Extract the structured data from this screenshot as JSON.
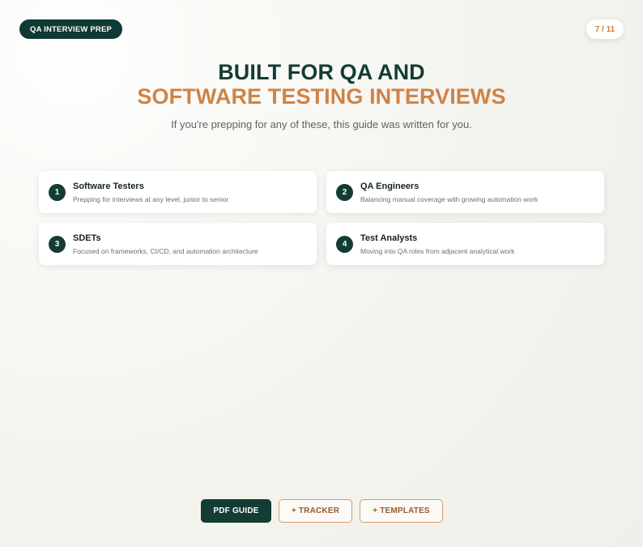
{
  "header": {
    "tag": "QA INTERVIEW PREP",
    "page_counter": "7 / 11"
  },
  "hero": {
    "title_line1": "BUILT FOR QA AND",
    "title_line2": "SOFTWARE TESTING INTERVIEWS",
    "subtitle": "If you're prepping for any of these, this guide was written for you."
  },
  "audiences": [
    {
      "num": "1",
      "title": "Software Testers",
      "desc": "Prepping for interviews at any level, junior to senior"
    },
    {
      "num": "2",
      "title": "QA Engineers",
      "desc": "Balancing manual coverage with growing automation work"
    },
    {
      "num": "3",
      "title": "SDETs",
      "desc": "Focused on frameworks, CI/CD, and automation architecture"
    },
    {
      "num": "4",
      "title": "Test Analysts",
      "desc": "Moving into QA roles from adjacent analytical work"
    }
  ],
  "actions": {
    "pdf_label": "PDF GUIDE",
    "tracker_label": "+ TRACKER",
    "templates_label": "+ TEMPLATES"
  },
  "colors": {
    "primary": "#123c34",
    "accent": "#cf8346"
  }
}
